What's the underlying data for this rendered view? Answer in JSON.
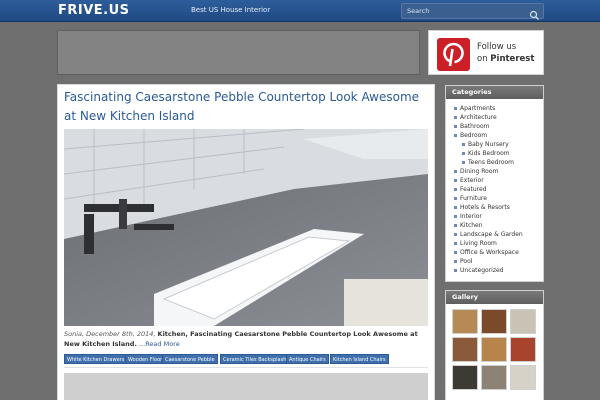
{
  "header": {
    "logo": "FRIVE.US",
    "tagline": "Best US House Interior",
    "search_placeholder": "Search",
    "colors": {
      "bar": "#2b5a98",
      "accent": "#2a5a96"
    }
  },
  "pinterest": {
    "line1": "Follow us",
    "line2_prefix": "on ",
    "line2_brand": "Pinterest",
    "icon": "pinterest-icon"
  },
  "post": {
    "title": "Fascinating Caesarstone Pebble Countertop Look Awesome at New Kitchen Island",
    "date": "Sonia, December 8th, 2014,",
    "categories": "Kitchen, Fascinating Caesarstone Pebble Countertop Look Awesome at New Kitchen Island.",
    "excerpt_suffix": " ...",
    "read_more": "Read More",
    "tags": [
      "White Kitchen Drawers",
      "Wooden Floor",
      "Caesarstone Pebble",
      "Ceramic Tiles Backsplash",
      "Antique Chairs",
      "Kitchen Island Chairs"
    ]
  },
  "sidebar": {
    "categories_title": "Categories",
    "categories": [
      {
        "label": "Apartments",
        "sub": false
      },
      {
        "label": "Architecture",
        "sub": false
      },
      {
        "label": "Bathroom",
        "sub": false
      },
      {
        "label": "Bedroom",
        "sub": false
      },
      {
        "label": "Baby Nursery",
        "sub": true
      },
      {
        "label": "Kids Bedroom",
        "sub": true
      },
      {
        "label": "Teens Bedroom",
        "sub": true
      },
      {
        "label": "Dining Room",
        "sub": false
      },
      {
        "label": "Exterior",
        "sub": false
      },
      {
        "label": "Featured",
        "sub": false
      },
      {
        "label": "Furniture",
        "sub": false
      },
      {
        "label": "Hotels & Resorts",
        "sub": false
      },
      {
        "label": "Interior",
        "sub": false
      },
      {
        "label": "Kitchen",
        "sub": false
      },
      {
        "label": "Landscape & Garden",
        "sub": false
      },
      {
        "label": "Living Room",
        "sub": false
      },
      {
        "label": "Office & Workspace",
        "sub": false
      },
      {
        "label": "Pool",
        "sub": false
      },
      {
        "label": "Uncategorized",
        "sub": false
      }
    ],
    "gallery_title": "Gallery",
    "gallery_colors": [
      "#b58a55",
      "#7a4a2a",
      "#c9c3b6",
      "#8a5a3a",
      "#b7844c",
      "#a8442e",
      "#3d3a33",
      "#8d8275",
      "#d6d2c8"
    ]
  }
}
